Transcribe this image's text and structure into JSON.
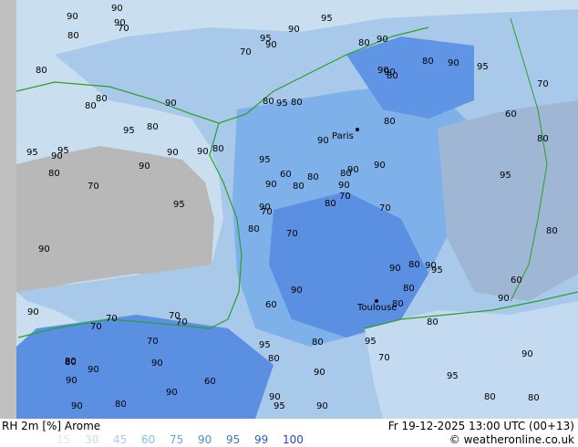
{
  "map_title": "RH 2m [%] Arome",
  "datetime": "Fr 19-12-2025 13:00 UTC (00+13)",
  "credit": "© weatheronline.co.uk",
  "legend": [
    {
      "value": "15",
      "color": "#d9e8f5"
    },
    {
      "value": "30",
      "color": "#c4daf0"
    },
    {
      "value": "45",
      "color": "#aecbe9"
    },
    {
      "value": "60",
      "color": "#7ec3f0"
    },
    {
      "value": "75",
      "color": "#5aaae6"
    },
    {
      "value": "90",
      "color": "#4a8fe0"
    },
    {
      "value": "95",
      "color": "#3d74da"
    },
    {
      "value": "99",
      "color": "#2f5fd0"
    },
    {
      "value": "100",
      "color": "#2545c8"
    }
  ],
  "cities": [
    {
      "name": "Paris"
    },
    {
      "name": "Toulouse"
    }
  ],
  "labels": [
    "70",
    "80",
    "70",
    "80",
    "80",
    "70",
    "90",
    "80",
    "90",
    "80",
    "70",
    "80",
    "70",
    "70",
    "80",
    "80",
    "80",
    "80",
    "90",
    "70",
    "80",
    "90",
    "90",
    "95",
    "90",
    "95",
    "80",
    "90",
    "80",
    "90",
    "80",
    "90",
    "95",
    "90",
    "90",
    "80",
    "70",
    "80",
    "90",
    "90",
    "95",
    "90",
    "90",
    "80",
    "90",
    "95",
    "90",
    "90",
    "80",
    "70",
    "70",
    "60",
    "80",
    "80",
    "70",
    "70",
    "90",
    "90",
    "80",
    "95",
    "90",
    "95",
    "95",
    "80",
    "90",
    "90",
    "80",
    "70",
    "60",
    "90",
    "60",
    "60",
    "80",
    "90",
    "80",
    "80",
    "95",
    "90",
    "95",
    "90",
    "80",
    "90",
    "70",
    "60",
    "90",
    "95",
    "90",
    "95",
    "90",
    "95",
    "95",
    "80",
    "90",
    "80",
    "80",
    "90",
    "90",
    "95",
    "90",
    "80"
  ]
}
